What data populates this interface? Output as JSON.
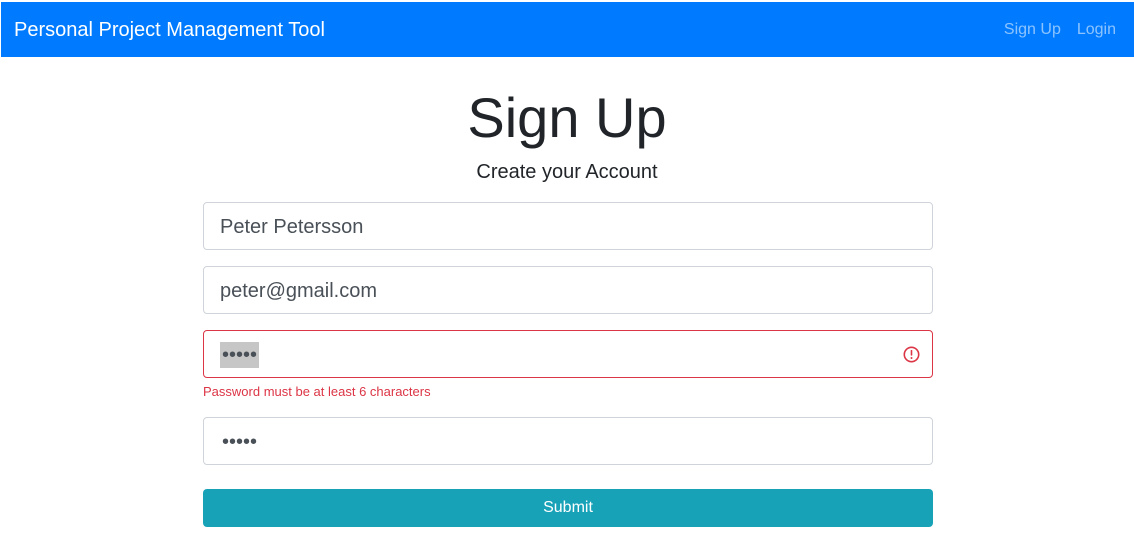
{
  "navbar": {
    "brand": "Personal Project Management Tool",
    "links": [
      "Sign Up",
      "Login"
    ],
    "bg_color": "#007bff"
  },
  "form": {
    "title": "Sign Up",
    "subtitle": "Create your Account",
    "name_value": "Peter Petersson",
    "email_value": "peter@gmail.com",
    "password_value": "•••••",
    "password_error": "Password must be at least 6 characters",
    "confirm_password_value": "•••••",
    "submit_label": "Submit",
    "error_color": "#dc3545",
    "submit_color": "#17a2b8",
    "error_icon": "exclamation-circle-icon"
  }
}
